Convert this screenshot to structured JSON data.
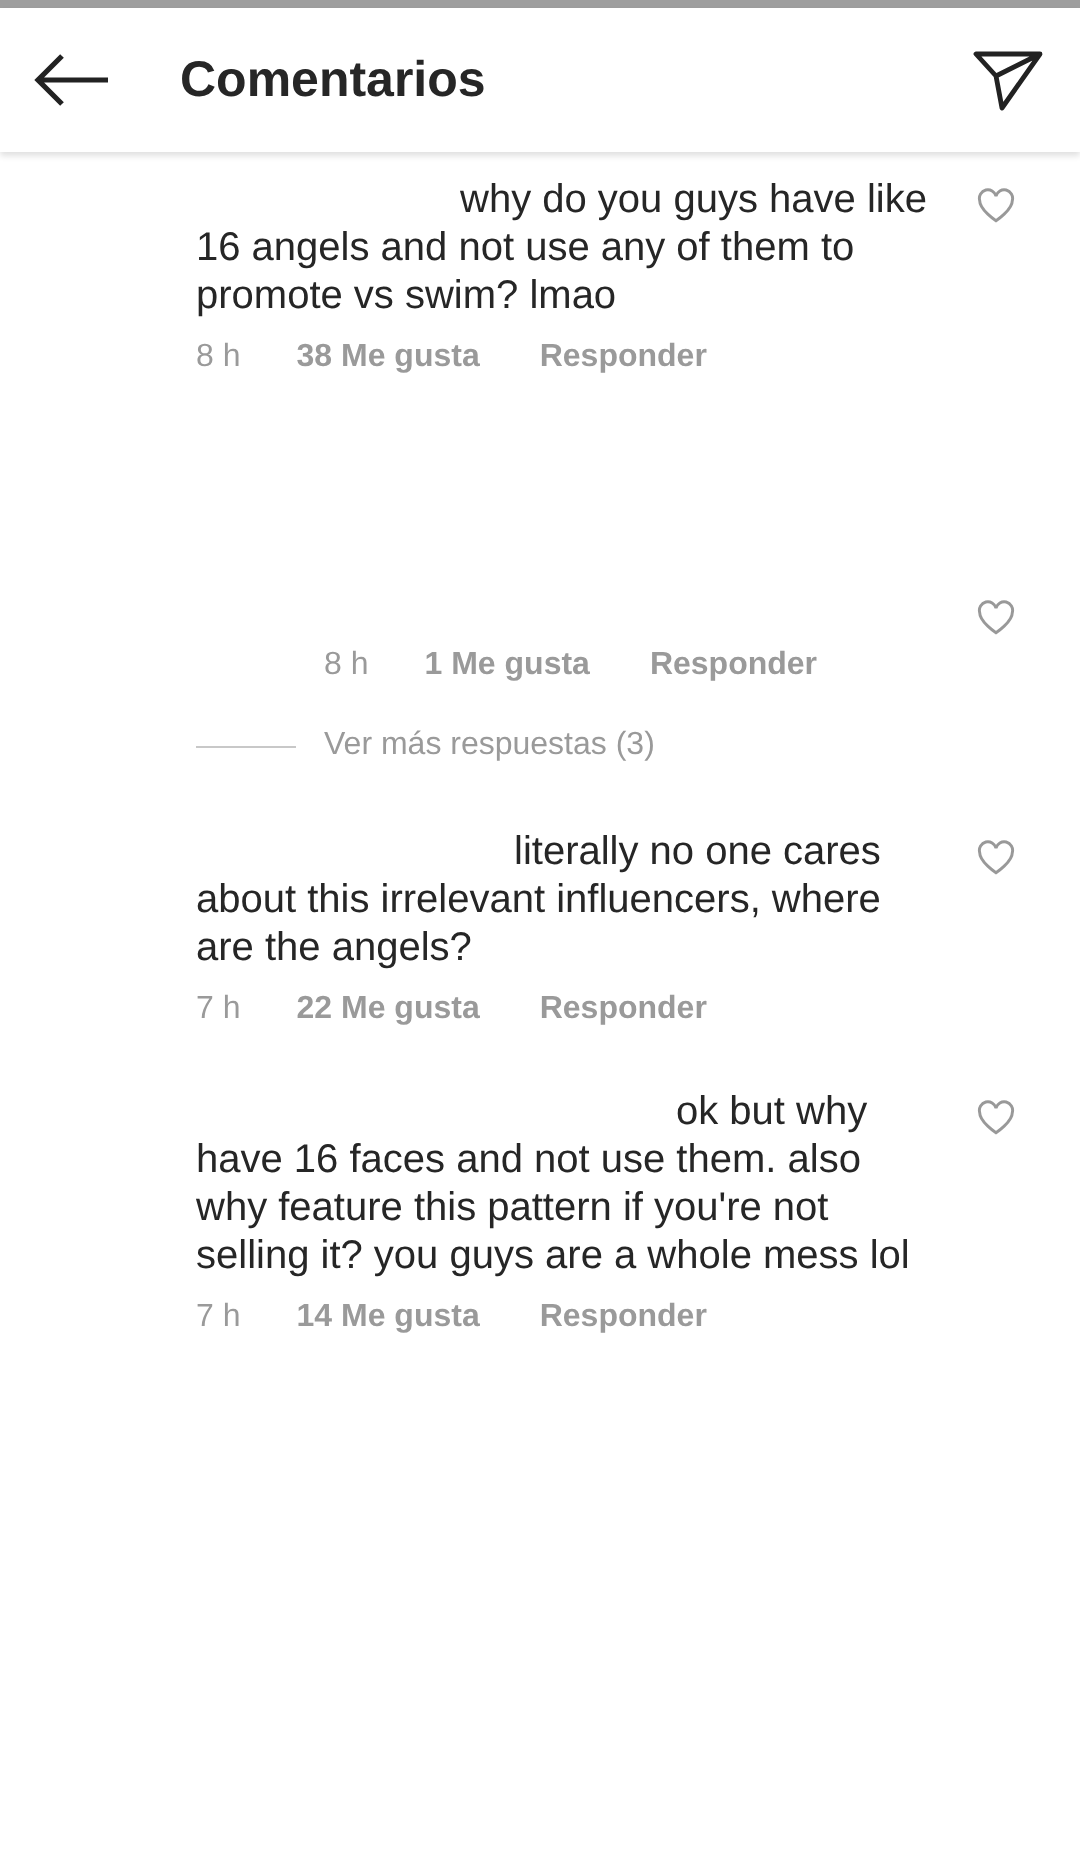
{
  "header": {
    "title": "Comentarios"
  },
  "comments": [
    {
      "kind": "comment",
      "text": "why do you guys have like 16 angels and not use any of them to promote vs swim? lmao",
      "time": "8 h",
      "likes": "38 Me gusta",
      "reply": "Responder"
    },
    {
      "kind": "reply",
      "time": "8 h",
      "likes": "1 Me gusta",
      "reply": "Responder"
    },
    {
      "kind": "more",
      "label": "Ver más respuestas (3)"
    },
    {
      "kind": "comment",
      "text": "literally no one cares about this irrelevant influencers, where are the angels?",
      "time": "7 h",
      "likes": "22 Me gusta",
      "reply": "Responder"
    },
    {
      "kind": "comment",
      "text": "ok but why have 16 faces and not use them. also why feature this pattern if you're not selling it? you guys are a whole mess lol",
      "time": "7 h",
      "likes": "14 Me gusta",
      "reply": "Responder"
    }
  ]
}
